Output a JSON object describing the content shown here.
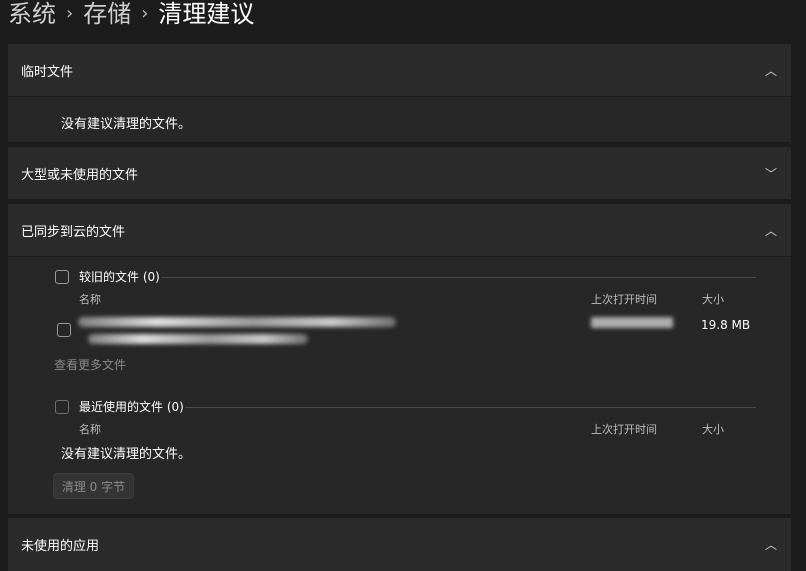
{
  "breadcrumb": {
    "items": [
      "系统",
      "存储",
      "清理建议"
    ]
  },
  "sections": {
    "temp": {
      "title": "临时文件",
      "empty_text": "没有建议清理的文件。"
    },
    "large": {
      "title": "大型或未使用的文件"
    },
    "cloud": {
      "title": "已同步到云的文件",
      "older": {
        "label": "较旧的文件 (0)",
        "columns": {
          "name": "名称",
          "last_opened": "上次打开时间",
          "size": "大小"
        },
        "file": {
          "size": "19.8 MB"
        },
        "see_more": "查看更多文件"
      },
      "recent": {
        "label": "最近使用的文件 (0)",
        "columns": {
          "name": "名称",
          "last_opened": "上次打开时间",
          "size": "大小"
        },
        "empty_text": "没有建议清理的文件。"
      },
      "clean_button": "清理 0 字节"
    },
    "apps": {
      "title": "未使用的应用"
    }
  },
  "colors": {
    "background": "#1c1c1c",
    "card": "#2b2b2b",
    "text": "#ffffff"
  },
  "icons": {
    "expanded": "chevron-up-icon",
    "collapsed": "chevron-down-icon"
  }
}
